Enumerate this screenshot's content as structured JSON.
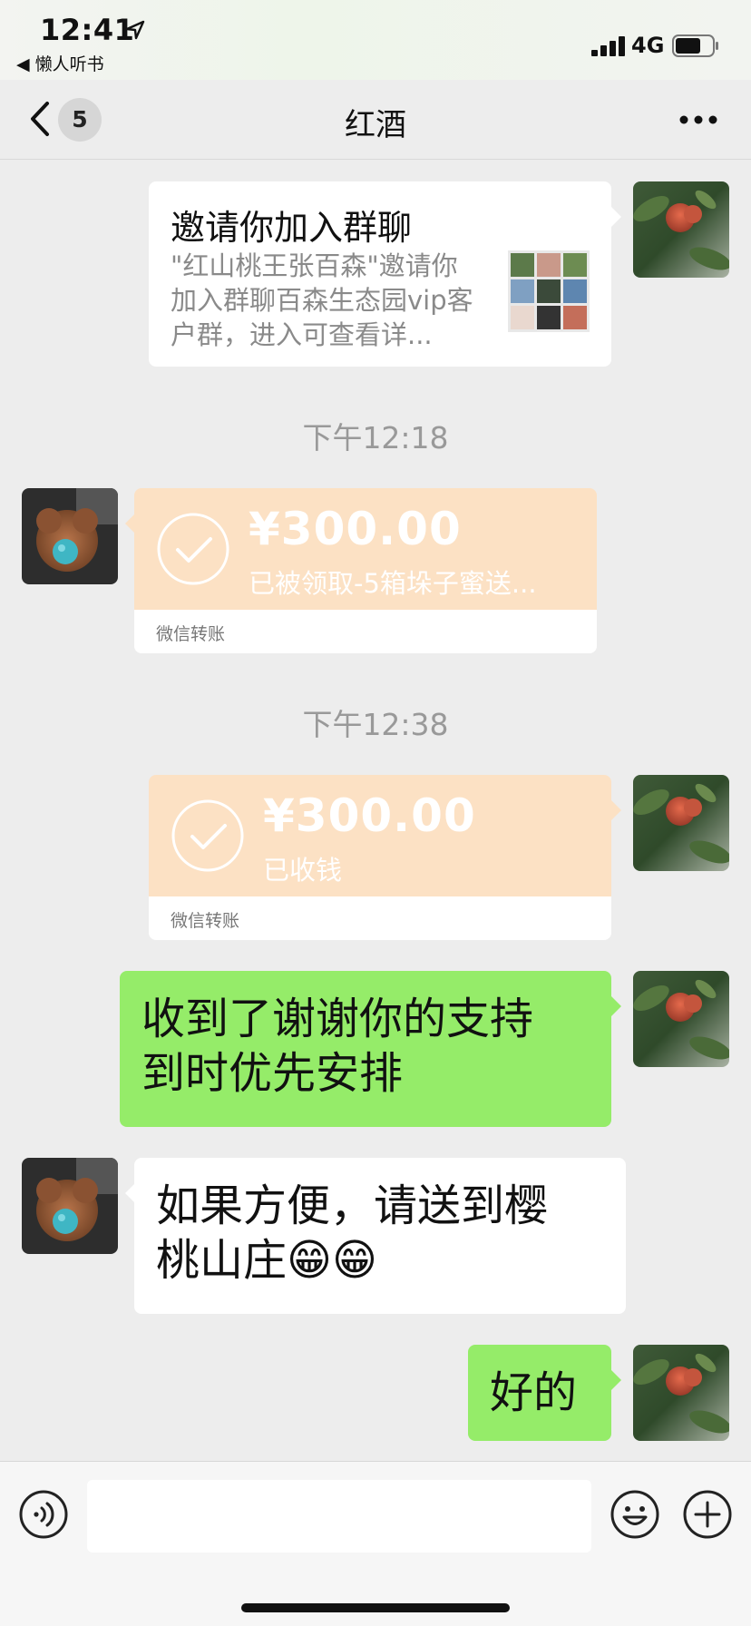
{
  "status_bar": {
    "time": "12:41",
    "back_app": "◀ 懒人听书",
    "network": "4G"
  },
  "nav": {
    "unread_count": "5",
    "title": "红酒"
  },
  "messages": {
    "invite": {
      "title": "邀请你加入群聊",
      "description": "\"红山桃王张百森\"邀请你加入群聊百森生态园vip客户群，进入可查看详..."
    },
    "timestamp_1": "下午12:18",
    "transfer_1": {
      "amount": "¥300.00",
      "note": "已被领取-5箱垛子蜜送...",
      "label": "微信转账"
    },
    "timestamp_2": "下午12:38",
    "transfer_2": {
      "amount": "¥300.00",
      "note": "已收钱",
      "label": "微信转账"
    },
    "text_1_line1": "收到了谢谢你的支持",
    "text_1_line2": "到时优先安排",
    "text_2_line1": "如果方便，请送到樱",
    "text_2_line2": "桃山庄😁😁",
    "text_3": "好的"
  },
  "input": {
    "placeholder": ""
  },
  "colors": {
    "sent_bubble": "#95ec69",
    "received_bubble": "#ffffff",
    "transfer_card": "#fce1c4",
    "background": "#ededed"
  },
  "icons": {
    "voice": "voice-icon",
    "emoji": "emoji-icon",
    "plus": "plus-icon",
    "back": "chevron-left-icon",
    "more": "more-icon"
  }
}
